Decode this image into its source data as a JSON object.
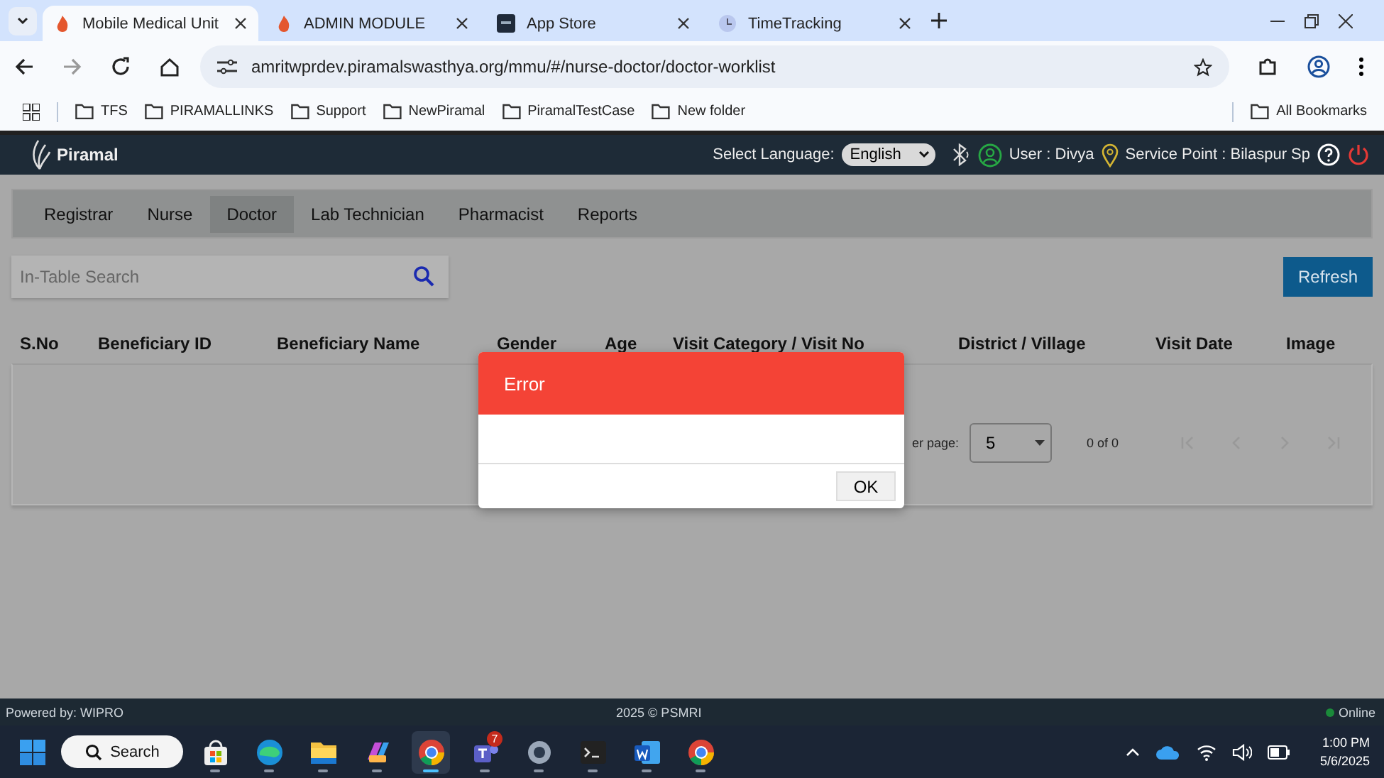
{
  "browser": {
    "tabs": [
      {
        "title": "Mobile Medical Unit",
        "selected": true,
        "kind": "flame"
      },
      {
        "title": "ADMIN MODULE",
        "selected": false,
        "kind": "flame"
      },
      {
        "title": "App Store",
        "selected": false,
        "kind": "store"
      },
      {
        "title": "TimeTracking",
        "selected": false,
        "kind": "clock"
      }
    ],
    "url": "amritwprdev.piramalswasthya.org/mmu/#/nurse-doctor/doctor-worklist",
    "bookmarks": [
      "TFS",
      "PIRAMALLINKS",
      "Support",
      "NewPiramal",
      "PiramalTestCase",
      "New folder"
    ],
    "all_bookmarks": "All Bookmarks"
  },
  "app": {
    "brand": "Piramal",
    "language_label": "Select Language:",
    "language": "English",
    "user": "User : Divya",
    "service_point": "Service Point : Bilaspur Sp",
    "nav": [
      {
        "label": "Registrar",
        "selected": false
      },
      {
        "label": "Nurse",
        "selected": false
      },
      {
        "label": "Doctor",
        "selected": true
      },
      {
        "label": "Lab Technician",
        "selected": false
      },
      {
        "label": "Pharmacist",
        "selected": false
      },
      {
        "label": "Reports",
        "selected": false
      }
    ],
    "search": {
      "placeholder": "In-Table Search"
    },
    "refresh": "Refresh",
    "columns": [
      "S.No",
      "Beneficiary ID",
      "Beneficiary Name",
      "Gender",
      "Age",
      "Visit Category / Visit No",
      "District / Village",
      "Visit Date",
      "Image"
    ],
    "paginator": {
      "label": "er page:",
      "page_size": "5",
      "range": "0 of 0"
    },
    "dialog": {
      "title": "Error",
      "button": "OK"
    },
    "footer": {
      "powered": "Powered by: WIPRO",
      "copyright": "2025 © PSMRI",
      "status": "Online"
    }
  },
  "taskbar": {
    "search": "Search",
    "apps": [
      {
        "kind": "store",
        "active": false
      },
      {
        "kind": "edge",
        "active": false
      },
      {
        "kind": "files",
        "active": false
      },
      {
        "kind": "m365",
        "active": false
      },
      {
        "kind": "chrome",
        "active": true
      },
      {
        "kind": "teams",
        "active": false,
        "badge": "7"
      },
      {
        "kind": "settings",
        "active": false
      },
      {
        "kind": "terminal",
        "active": false
      },
      {
        "kind": "word",
        "active": false
      },
      {
        "kind": "chrome",
        "active": false
      }
    ],
    "time": "1:00 PM",
    "date": "5/6/2025"
  }
}
